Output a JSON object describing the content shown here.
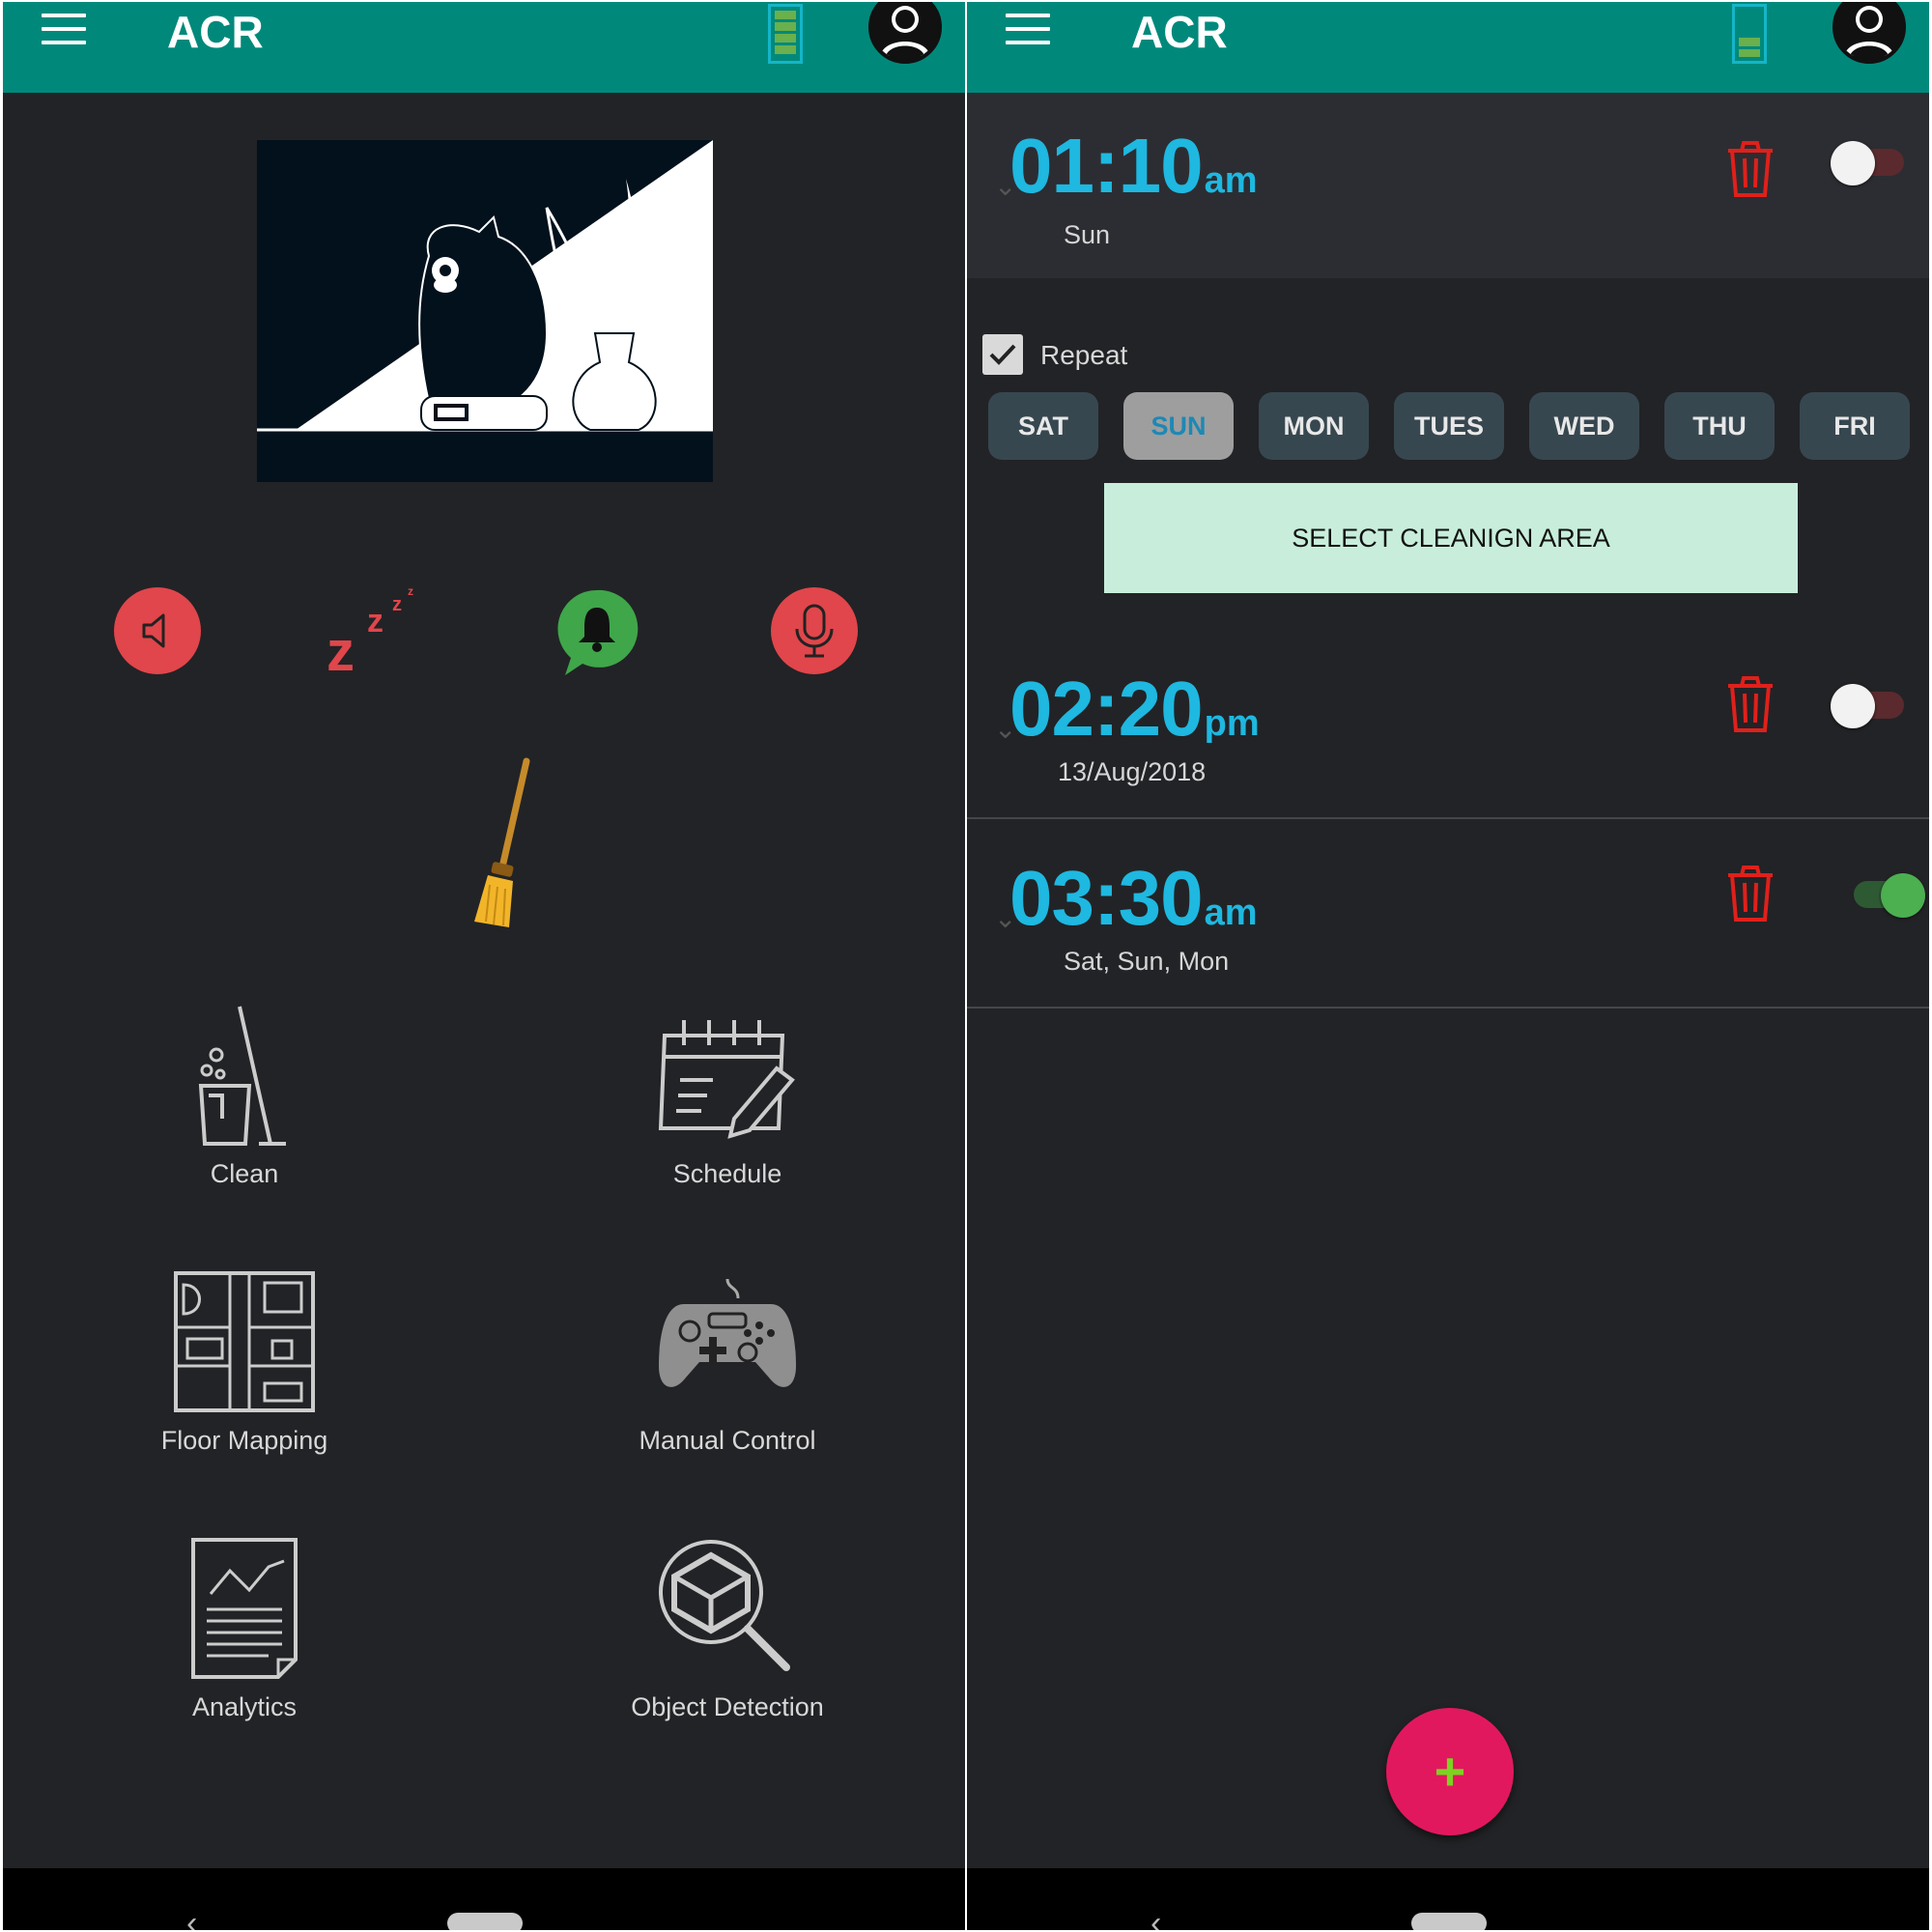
{
  "left": {
    "appbar": {
      "title": "ACR",
      "menu_icon": "hamburger-icon",
      "battery_icon": "battery-icon",
      "avatar_icon": "account-avatar-icon"
    },
    "quick_actions": [
      {
        "name": "speaker-icon",
        "color": "#e0464b"
      },
      {
        "name": "sleep-zzz-icon",
        "color": "#e0464b"
      },
      {
        "name": "notification-bell-icon",
        "color": "#3fa64a"
      },
      {
        "name": "microphone-icon",
        "color": "#e0464b"
      }
    ],
    "menu": {
      "clean": "Clean",
      "schedule": "Schedule",
      "floor_mapping": "Floor Mapping",
      "manual_control": "Manual Control",
      "analytics": "Analytics",
      "object_detection": "Object Detection"
    },
    "nav": {
      "back": "‹"
    }
  },
  "right": {
    "appbar": {
      "title": "ACR"
    },
    "alarms": [
      {
        "time": "01:10",
        "ampm": "am",
        "sub": "Sun",
        "enabled": false
      },
      {
        "time": "02:20",
        "ampm": "pm",
        "sub": "13/Aug/2018",
        "enabled": false
      },
      {
        "time": "03:30",
        "ampm": "am",
        "sub": "Sat, Sun, Mon",
        "enabled": true
      }
    ],
    "repeat": {
      "label": "Repeat",
      "checked": true
    },
    "days": [
      "SAT",
      "SUN",
      "MON",
      "TUES",
      "WED",
      "THU",
      "FRI"
    ],
    "selected_day": "SUN",
    "select_area_label": "SELECT CLEANIGN AREA",
    "fab_label": "+",
    "nav": {
      "back": "‹"
    }
  },
  "colors": {
    "appbar": "#00897b",
    "background": "#222326",
    "accent_time": "#1eb8e0",
    "delete_red": "#e0201b",
    "toggle_on": "#4caf50",
    "fab": "#e2185e",
    "fab_plus": "#7cd320"
  }
}
